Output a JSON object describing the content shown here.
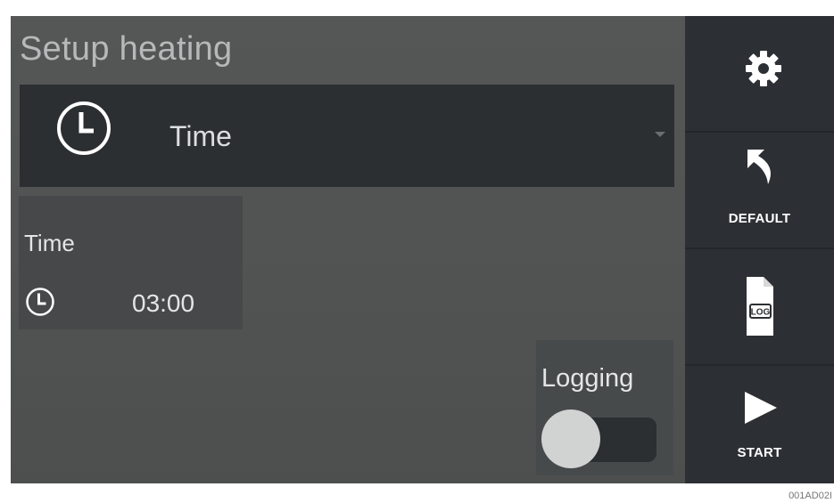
{
  "header": {
    "title": "Setup heating"
  },
  "mode_select": {
    "icon": "clock-icon",
    "selected": "Time"
  },
  "time_card": {
    "label": "Time",
    "icon": "clock-icon",
    "value": "03:00"
  },
  "logging": {
    "label": "Logging",
    "enabled": false
  },
  "sidebar": {
    "settings": {
      "icon": "gear-icon"
    },
    "default": {
      "icon": "undo-arrow-icon",
      "label": "DEFAULT"
    },
    "log": {
      "icon": "log-file-icon",
      "label_on_icon": "LOG"
    },
    "start": {
      "icon": "play-icon",
      "label": "START"
    }
  },
  "footer": {
    "figure_id": "001AD02I"
  },
  "colors": {
    "background": "#525454",
    "panel_dark": "#2c2f31",
    "sidebar": "#23272b",
    "sidebar_button": "#2c3034",
    "text_light": "#e3e5e6",
    "title_text": "#b6b9b9",
    "toggle_knob": "#d1d3d3"
  }
}
